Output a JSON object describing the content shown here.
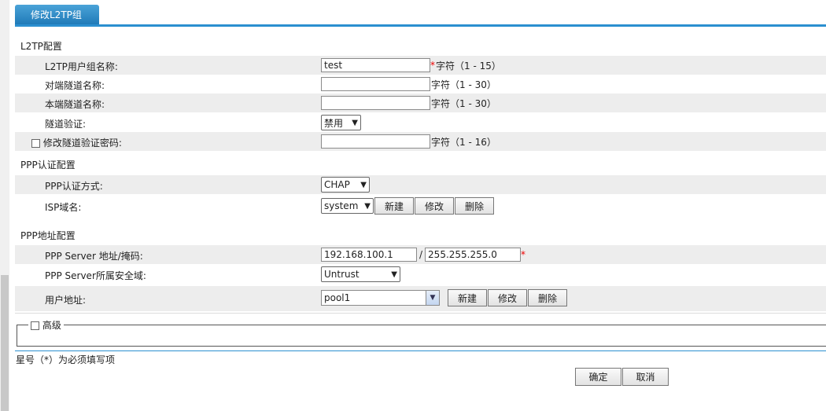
{
  "tab": {
    "label": "修改L2TP组"
  },
  "l2tp_section": {
    "title": "L2TP配置"
  },
  "group_name": {
    "label": "L2TP用户组名称:",
    "value": "test",
    "required": "*",
    "hint": "字符（1 - 15）"
  },
  "peer_tunnel": {
    "label": "对端隧道名称:",
    "value": "",
    "hint": "字符（1 - 30）"
  },
  "local_tunnel": {
    "label": "本端隧道名称:",
    "value": "",
    "hint": "字符（1 - 30）"
  },
  "tunnel_auth": {
    "label": "隧道验证:",
    "selected": "禁用"
  },
  "change_pwd": {
    "label": "修改隧道验证密码:",
    "value": "",
    "hint": "字符（1 - 16）"
  },
  "ppp_auth_section": {
    "title": "PPP认证配置"
  },
  "ppp_auth_mode": {
    "label": "PPP认证方式:",
    "selected": "CHAP"
  },
  "isp_domain": {
    "label": "ISP域名:",
    "selected": "system",
    "new": "新建",
    "edit": "修改",
    "delete": "删除"
  },
  "ppp_addr_section": {
    "title": "PPP地址配置"
  },
  "ppp_server": {
    "label": "PPP Server 地址/掩码:",
    "address": "192.168.100.1",
    "slash": "/",
    "mask": "255.255.255.0",
    "required": "*"
  },
  "ppp_zone": {
    "label": "PPP Server所属安全域:",
    "selected": "Untrust"
  },
  "user_addr": {
    "label": "用户地址:",
    "selected": "pool1",
    "new": "新建",
    "edit": "修改",
    "delete": "删除"
  },
  "advanced": {
    "label": "高级"
  },
  "footnote": "星号（*）为必须填写项",
  "actions": {
    "ok": "确定",
    "cancel": "取消"
  },
  "colors": {
    "accent": "#2b8fd0",
    "required": "#ee0000",
    "row_shade": "#ededed"
  }
}
